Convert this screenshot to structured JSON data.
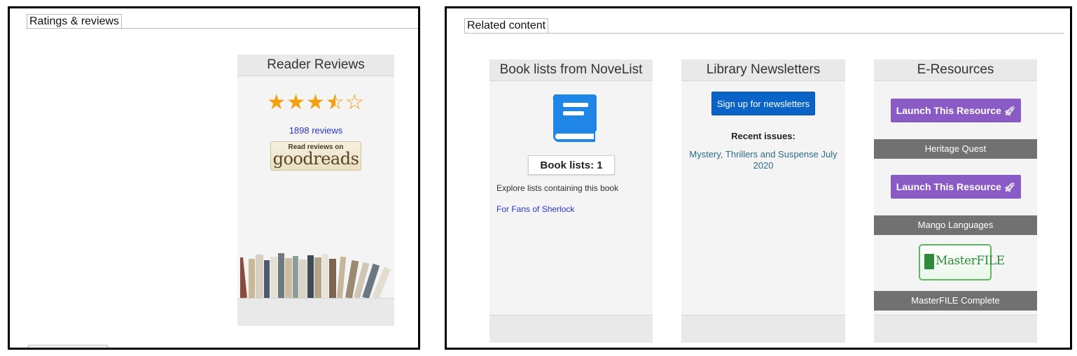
{
  "left_section": {
    "tab_label": "Ratings & reviews",
    "panel": {
      "title": "Reader Reviews",
      "rating_stars": 3.5,
      "rating_max": 5,
      "reviews_count_label": "1898 reviews",
      "badge": {
        "small": "Read reviews on",
        "brand": "goodreads"
      }
    }
  },
  "right_section": {
    "tab_label": "Related content",
    "novelist": {
      "title": "Book lists from NoveList",
      "icon": "book-icon",
      "booklists_label": "Book lists: 1",
      "explore_text": "Explore lists containing this book",
      "list_link": "For Fans of Sherlock"
    },
    "newsletters": {
      "title": "Library Newsletters",
      "signup_button": "Sign up for newsletters",
      "recent_label": "Recent issues:",
      "issue_link": "Mystery, Thrillers and Suspense July 2020"
    },
    "eresources": {
      "title": "E-Resources",
      "launch_label": "Launch This Resource",
      "launch_icon": "rocket-icon",
      "resources": [
        "Heritage Quest",
        "Mango Languages",
        "MasterFILE Complete"
      ],
      "masterfile_logo": "MasterFILE"
    }
  },
  "colors": {
    "star": "#f5a10f",
    "link": "#2b35c9",
    "signup_button": "#0a63c7",
    "launch_button": "#8a5bc4",
    "resource_bar": "#717171",
    "book_icon": "#1f86e8"
  }
}
